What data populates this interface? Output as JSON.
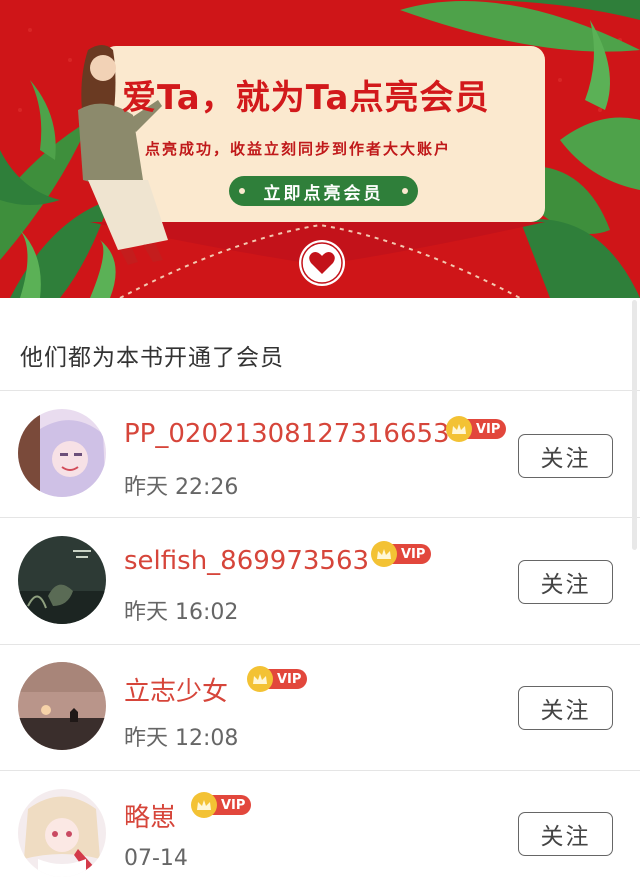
{
  "banner": {
    "headline": "爱Ta，就为Ta点亮会员",
    "subline": "点亮成功，收益立刻同步到作者大大账户",
    "cta_label": "立即点亮会员",
    "colors": {
      "background": "#cf1518",
      "card": "#fbe9cf",
      "cta": "#2f7f3a",
      "leaf": "#3e8f3c"
    }
  },
  "section_title": "他们都为本书开通了会员",
  "vip_badge_label": "VIP",
  "members": [
    {
      "name": "PP_02021308127316653",
      "time": "昨天 22:26",
      "follow_label": "关注",
      "avatar": "anime-girl-lavender"
    },
    {
      "name": "selfish_869973563",
      "time": "昨天 16:02",
      "follow_label": "关注",
      "avatar": "dark-green-scene"
    },
    {
      "name": "立志少女",
      "time": "昨天 12:08",
      "follow_label": "关注",
      "avatar": "sunset-silhouette"
    },
    {
      "name": "略崽",
      "time": "07-14",
      "follow_label": "关注",
      "avatar": "anime-girl-blonde"
    }
  ],
  "colors": {
    "name": "#d6453a",
    "vip_tag": "#e2473c",
    "crown": "#f3c234"
  }
}
